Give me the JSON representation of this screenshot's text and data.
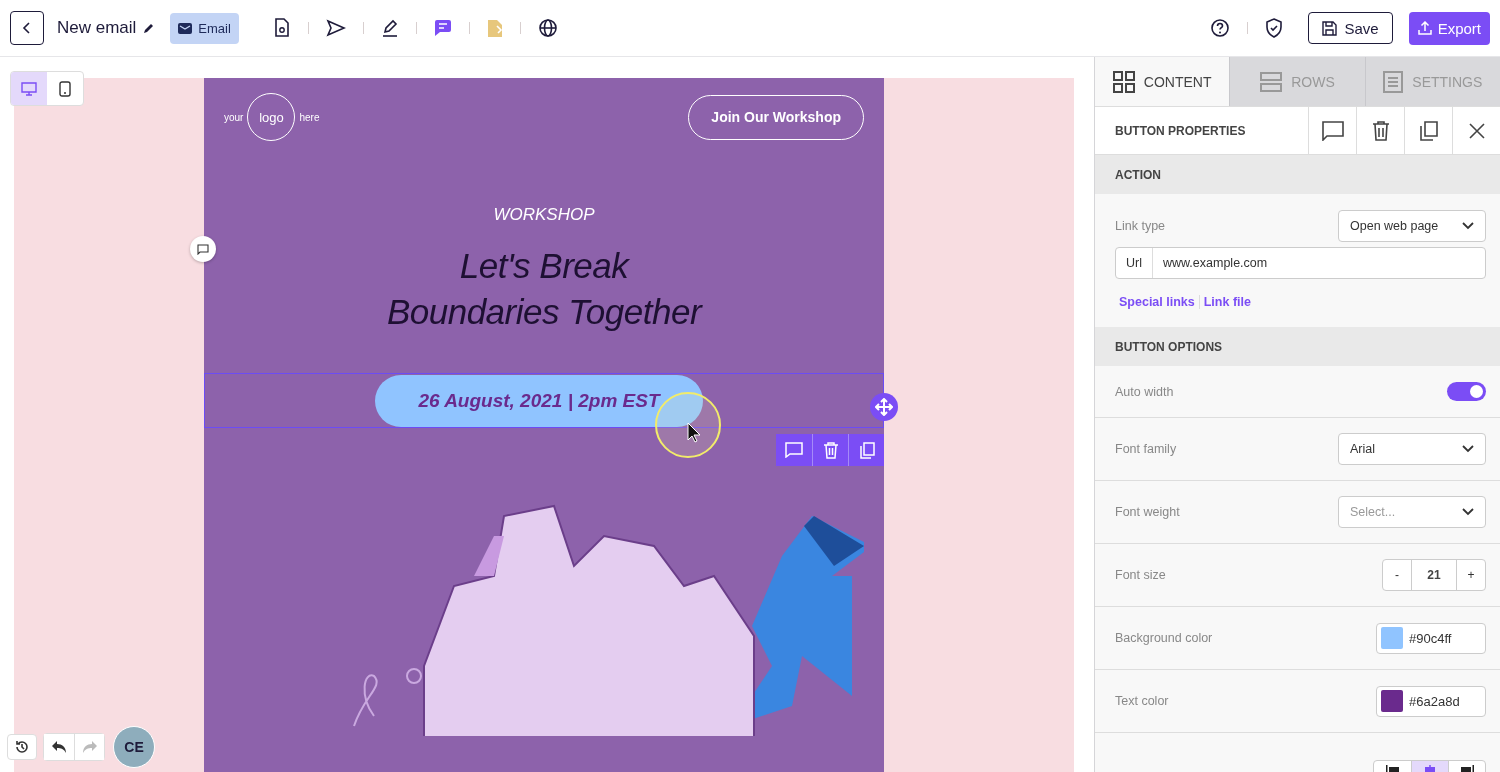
{
  "header": {
    "title": "New email",
    "badge": "Email",
    "save": "Save",
    "export": "Export"
  },
  "view_modes": [
    {
      "kind": "desktop",
      "selected": true
    },
    {
      "kind": "mobile",
      "selected": false
    }
  ],
  "email": {
    "logo": {
      "left": "your",
      "center": "logo",
      "right": "here"
    },
    "header_button": "Join Our Workshop",
    "eyebrow": "WORKSHOP",
    "headline": [
      "Let's Break",
      "Boundaries Together"
    ],
    "date_button": "26 August, 2021 | 2pm EST"
  },
  "avatar": "CE",
  "panel": {
    "tabs": [
      {
        "kind": "content",
        "label": "CONTENT",
        "selected": true
      },
      {
        "kind": "rows",
        "label": "ROWS",
        "selected": false
      },
      {
        "kind": "settings",
        "label": "SETTINGS",
        "selected": false
      }
    ],
    "title": "BUTTON PROPERTIES",
    "action": {
      "title": "ACTION",
      "link_type": {
        "label": "Link type",
        "value": "Open web page"
      },
      "url": {
        "prefix": "Url",
        "value": "www.example.com"
      },
      "links": [
        "Special links",
        "Link file"
      ]
    },
    "options": {
      "title": "BUTTON OPTIONS",
      "rows": [
        {
          "kind": "toggle",
          "label": "Auto width",
          "on": true
        },
        {
          "kind": "select",
          "label": "Font family",
          "value": "Arial"
        },
        {
          "kind": "select",
          "label": "Font weight",
          "placeholder": "Select..."
        },
        {
          "kind": "stepper",
          "label": "Font size",
          "minus": "-",
          "value": "21",
          "plus": "+"
        },
        {
          "kind": "color",
          "label": "Background color",
          "color": "#90c4ff",
          "value": "#90c4ff"
        },
        {
          "kind": "color",
          "label": "Text color",
          "color": "#6a2a8d",
          "value": "#6a2a8d"
        },
        {
          "kind": "align",
          "options": [
            {
              "selected": false
            },
            {
              "selected": true
            },
            {
              "selected": false
            }
          ]
        }
      ]
    }
  }
}
